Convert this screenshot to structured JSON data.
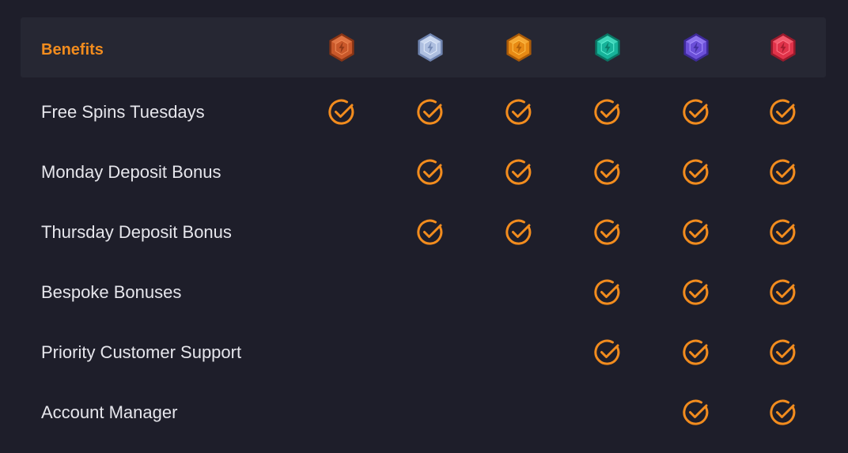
{
  "header": {
    "title": "Benefits",
    "tiers": [
      {
        "icon": "bronze-gem-icon",
        "color": "#c9582a",
        "light": "#f08a55",
        "dark": "#8a3515"
      },
      {
        "icon": "silver-gem-icon",
        "color": "#aebfe0",
        "light": "#e2ebfb",
        "dark": "#6f84b0"
      },
      {
        "icon": "gold-gem-icon",
        "color": "#e88a14",
        "light": "#ffc04a",
        "dark": "#a95a08"
      },
      {
        "icon": "emerald-gem-icon",
        "color": "#17b39a",
        "light": "#5ff0d4",
        "dark": "#0a7665"
      },
      {
        "icon": "amethyst-gem-icon",
        "color": "#6b4fd8",
        "light": "#a892ff",
        "dark": "#3e2a9a"
      },
      {
        "icon": "ruby-gem-icon",
        "color": "#e0334a",
        "light": "#ff7a8b",
        "dark": "#9a1a2c"
      }
    ]
  },
  "colors": {
    "accent": "#f28c1e",
    "background": "#1e1e2a",
    "header_background": "#262733",
    "label_text": "#e6e6ec"
  },
  "benefits": [
    {
      "label": "Free Spins Tuesdays",
      "included": [
        true,
        true,
        true,
        true,
        true,
        true
      ]
    },
    {
      "label": "Monday Deposit Bonus",
      "included": [
        false,
        true,
        true,
        true,
        true,
        true
      ]
    },
    {
      "label": "Thursday Deposit Bonus",
      "included": [
        false,
        true,
        true,
        true,
        true,
        true
      ]
    },
    {
      "label": "Bespoke Bonuses",
      "included": [
        false,
        false,
        false,
        true,
        true,
        true
      ]
    },
    {
      "label": "Priority Customer Support",
      "included": [
        false,
        false,
        false,
        true,
        true,
        true
      ]
    },
    {
      "label": "Account Manager",
      "included": [
        false,
        false,
        false,
        false,
        true,
        true
      ]
    }
  ]
}
